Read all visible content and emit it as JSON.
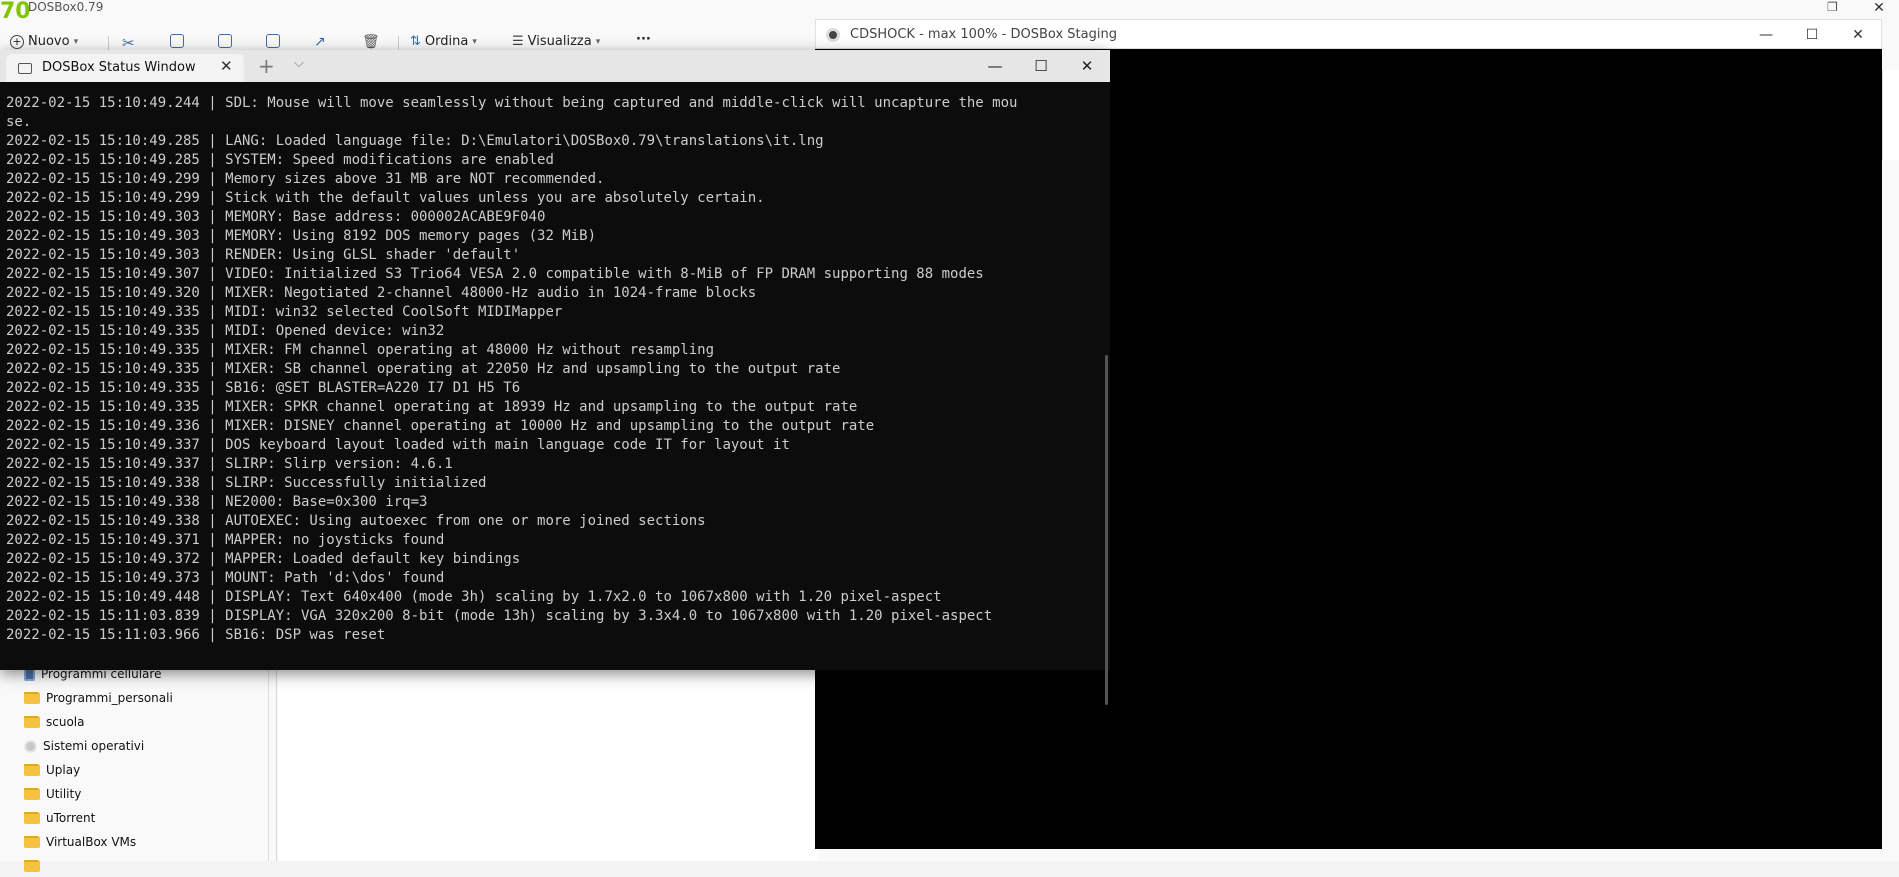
{
  "explorer": {
    "logo_text": "70",
    "title": "DOSBox0.79",
    "close_glyph": "✕",
    "restore_glyph": "❐",
    "toolbar": {
      "new_label": "Nuovo",
      "sort_label": "Ordina",
      "view_label": "Visualizza",
      "more_glyph": "···"
    },
    "nav_items": [
      {
        "label": "Programmi cellulare",
        "icon": "phone-icon"
      },
      {
        "label": "Programmi_personali",
        "icon": "folder-icon"
      },
      {
        "label": "scuola",
        "icon": "folder-icon"
      },
      {
        "label": "Sistemi operativi",
        "icon": "disk-icon"
      },
      {
        "label": "Uplay",
        "icon": "folder-icon"
      },
      {
        "label": "Utility",
        "icon": "folder-icon"
      },
      {
        "label": "uTorrent",
        "icon": "folder-icon"
      },
      {
        "label": "VirtualBox VMs",
        "icon": "folder-icon"
      }
    ]
  },
  "dosbox": {
    "title": "CDSHOCK - max 100% - DOSBox Staging",
    "minimize_glyph": "—",
    "maximize_glyph": "☐",
    "close_glyph": "✕"
  },
  "terminal": {
    "tab_title": "DOSBox Status Window",
    "tab_close_glyph": "✕",
    "new_tab_glyph": "+",
    "dropdown_glyph": "⌵",
    "minimize_glyph": "—",
    "maximize_glyph": "☐",
    "close_glyph": "✕",
    "lines": [
      "2022-02-15 15:10:49.244 | SDL: Mouse will move seamlessly without being captured and middle-click will uncapture the mou",
      "se.",
      "2022-02-15 15:10:49.285 | LANG: Loaded language file: D:\\Emulatori\\DOSBox0.79\\translations\\it.lng",
      "2022-02-15 15:10:49.285 | SYSTEM: Speed modifications are enabled",
      "2022-02-15 15:10:49.299 | Memory sizes above 31 MB are NOT recommended.",
      "2022-02-15 15:10:49.299 | Stick with the default values unless you are absolutely certain.",
      "2022-02-15 15:10:49.303 | MEMORY: Base address: 000002ACABE9F040",
      "2022-02-15 15:10:49.303 | MEMORY: Using 8192 DOS memory pages (32 MiB)",
      "2022-02-15 15:10:49.303 | RENDER: Using GLSL shader 'default'",
      "2022-02-15 15:10:49.307 | VIDEO: Initialized S3 Trio64 VESA 2.0 compatible with 8-MiB of FP DRAM supporting 88 modes",
      "2022-02-15 15:10:49.320 | MIXER: Negotiated 2-channel 48000-Hz audio in 1024-frame blocks",
      "2022-02-15 15:10:49.335 | MIDI: win32 selected CoolSoft MIDIMapper",
      "2022-02-15 15:10:49.335 | MIDI: Opened device: win32",
      "2022-02-15 15:10:49.335 | MIXER: FM channel operating at 48000 Hz without resampling",
      "2022-02-15 15:10:49.335 | MIXER: SB channel operating at 22050 Hz and upsampling to the output rate",
      "2022-02-15 15:10:49.335 | SB16: @SET BLASTER=A220 I7 D1 H5 T6",
      "2022-02-15 15:10:49.335 | MIXER: SPKR channel operating at 18939 Hz and upsampling to the output rate",
      "2022-02-15 15:10:49.336 | MIXER: DISNEY channel operating at 10000 Hz and upsampling to the output rate",
      "2022-02-15 15:10:49.337 | DOS keyboard layout loaded with main language code IT for layout it",
      "2022-02-15 15:10:49.337 | SLIRP: Slirp version: 4.6.1",
      "2022-02-15 15:10:49.338 | SLIRP: Successfully initialized",
      "2022-02-15 15:10:49.338 | NE2000: Base=0x300 irq=3",
      "2022-02-15 15:10:49.338 | AUTOEXEC: Using autoexec from one or more joined sections",
      "2022-02-15 15:10:49.371 | MAPPER: no joysticks found",
      "2022-02-15 15:10:49.372 | MAPPER: Loaded default key bindings",
      "2022-02-15 15:10:49.373 | MOUNT: Path 'd:\\dos' found",
      "2022-02-15 15:10:49.448 | DISPLAY: Text 640x400 (mode 3h) scaling by 1.7x2.0 to 1067x800 with 1.20 pixel-aspect",
      "2022-02-15 15:11:03.839 | DISPLAY: VGA 320x200 8-bit (mode 13h) scaling by 3.3x4.0 to 1067x800 with 1.20 pixel-aspect",
      "2022-02-15 15:11:03.966 | SB16: DSP was reset"
    ]
  }
}
